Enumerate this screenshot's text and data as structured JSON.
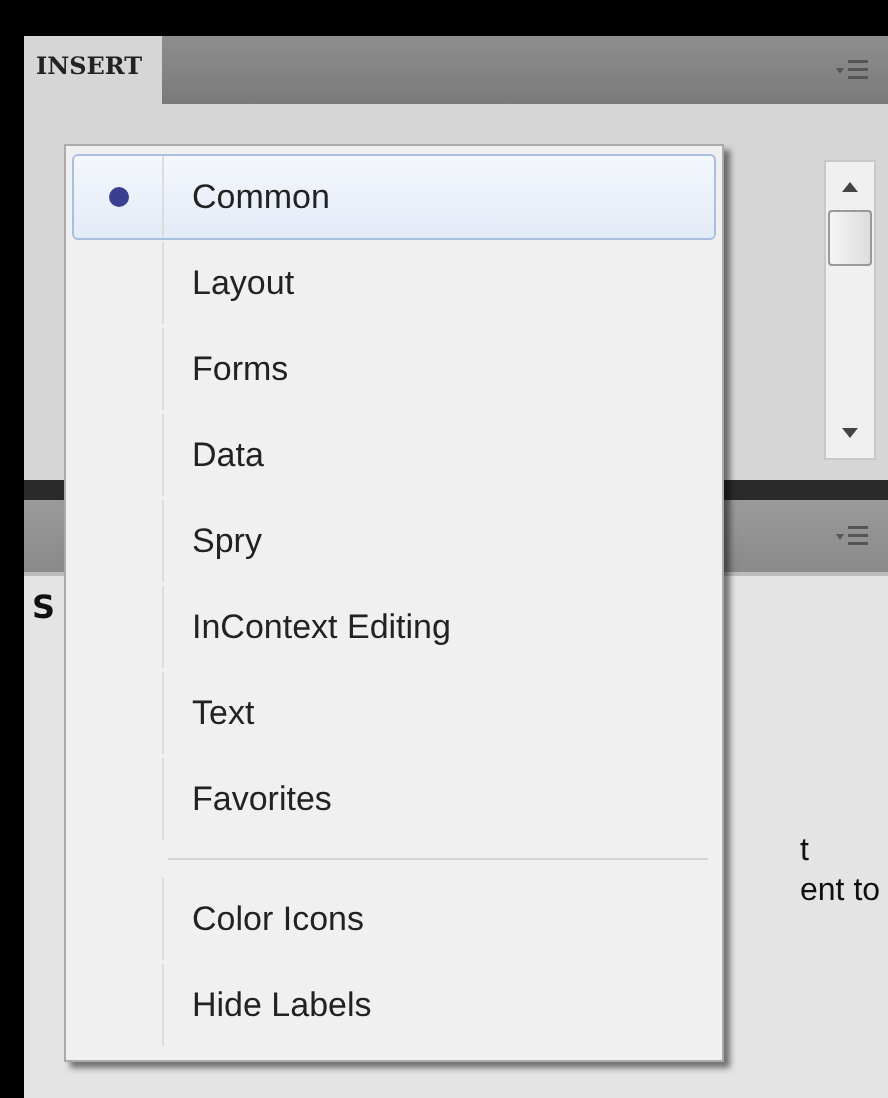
{
  "insert_panel": {
    "tab": {
      "label": "INSERT",
      "selected": true
    }
  },
  "lower_panel": {
    "heading": "S",
    "text_lines": [
      "t",
      "ent to"
    ]
  },
  "context_menu": {
    "items": [
      {
        "label": "Common",
        "kind": "radio",
        "selected": true
      },
      {
        "label": "Layout",
        "kind": "radio",
        "selected": false
      },
      {
        "label": "Forms",
        "kind": "radio",
        "selected": false
      },
      {
        "label": "Data",
        "kind": "radio",
        "selected": false
      },
      {
        "label": "Spry",
        "kind": "radio",
        "selected": false
      },
      {
        "label": "InContext Editing",
        "kind": "radio",
        "selected": false
      },
      {
        "label": "Text",
        "kind": "radio",
        "selected": false
      },
      {
        "label": "Favorites",
        "kind": "radio",
        "selected": false
      },
      {
        "kind": "separator"
      },
      {
        "label": "Color Icons",
        "kind": "command"
      },
      {
        "label": "Hide Labels",
        "kind": "command"
      }
    ]
  }
}
